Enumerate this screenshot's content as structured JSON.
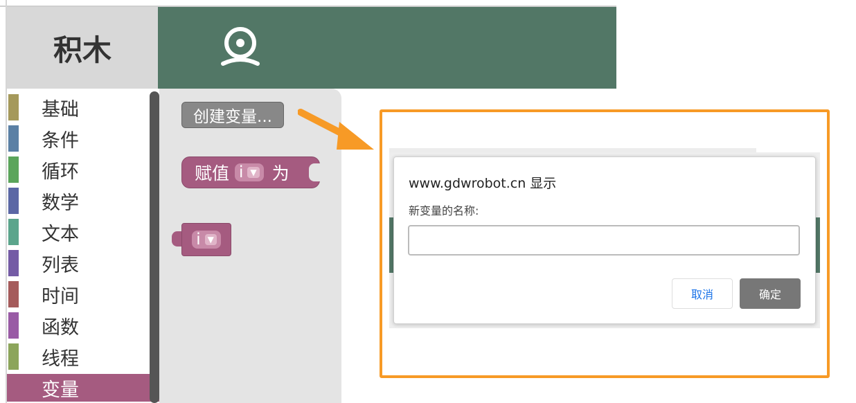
{
  "header": {
    "tab_blocks_label": "积木",
    "camera_icon": "webcam-icon",
    "header_color": "#527766"
  },
  "toolbox": {
    "categories": [
      {
        "label": "基础",
        "color": "#a5995b"
      },
      {
        "label": "条件",
        "color": "#5b80a5"
      },
      {
        "label": "循环",
        "color": "#5ba55b"
      },
      {
        "label": "数学",
        "color": "#5b67a5"
      },
      {
        "label": "文本",
        "color": "#5ba58c"
      },
      {
        "label": "列表",
        "color": "#745ba5"
      },
      {
        "label": "时间",
        "color": "#a55b5b"
      },
      {
        "label": "函数",
        "color": "#995ba5"
      },
      {
        "label": "线程",
        "color": "#8ca55b"
      },
      {
        "label": "变量",
        "color": "#a55b80"
      }
    ],
    "selected": "变量"
  },
  "flyout": {
    "create_variable_button": "创建变量...",
    "assign_block": {
      "prefix": "赋值",
      "var": "i",
      "suffix": "为"
    },
    "variable_block": {
      "var": "i"
    }
  },
  "dialog": {
    "title": "www.gdwrobot.cn 显示",
    "message": "新变量的名称:",
    "input_value": "",
    "cancel_label": "取消",
    "ok_label": "确定",
    "highlight_color": "#f79a26"
  }
}
